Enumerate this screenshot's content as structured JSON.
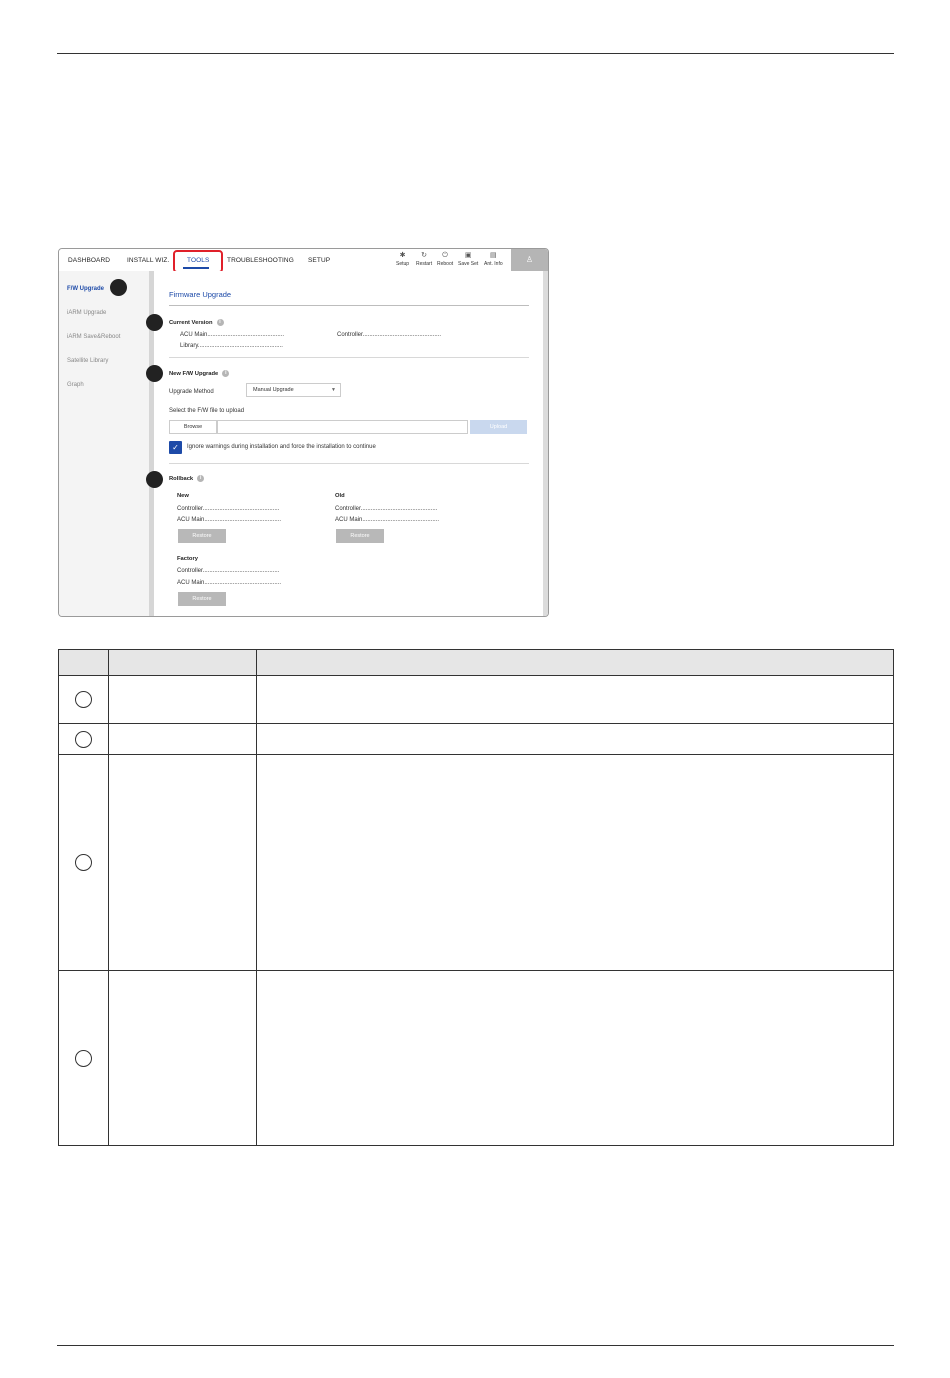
{
  "nav": {
    "tabs": [
      "DASHBOARD",
      "INSTALL WIZ.",
      "TOOLS",
      "TROUBLESHOOTING",
      "SETUP"
    ],
    "active_tab": "TOOLS",
    "tools": [
      {
        "label": "Setup",
        "icon": "gear-icon"
      },
      {
        "label": "Restart",
        "icon": "restart-icon"
      },
      {
        "label": "Reboot",
        "icon": "power-icon"
      },
      {
        "label": "Save Set",
        "icon": "save-icon"
      },
      {
        "label": "Ant. Info",
        "icon": "antenna-info-icon"
      }
    ],
    "user_icon": "user-icon"
  },
  "sidebar": {
    "items": [
      "F/W Upgrade",
      "iARM Upgrade",
      "iARM Save&Reboot",
      "Satellite Library",
      "Graph"
    ],
    "active_item": "F/W Upgrade"
  },
  "main": {
    "title": "Firmware Upgrade",
    "current_version": {
      "heading": "Current Version",
      "acu_main": "ACU Main..............................................",
      "controller": "Controller...............................................",
      "library": "Library..................................................."
    },
    "new_fw": {
      "heading": "New F/W Upgrade",
      "method_label": "Upgrade Method",
      "method_value": "Manual Upgrade",
      "select_file_label": "Select the F/W file to upload",
      "browse_label": "Browse",
      "upload_label": "Upload",
      "checkbox_label": "Ignore warnings during installation and force the installation to continue",
      "checkbox_checked": true
    },
    "rollback": {
      "heading": "Rollback",
      "new": {
        "heading": "New",
        "controller": "Controller..............................................",
        "acu_main": "ACU Main..............................................",
        "restore_label": "Restore"
      },
      "old": {
        "heading": "Old",
        "controller": "Controller..............................................",
        "acu_main": "ACU Main..............................................",
        "restore_label": "Restore"
      },
      "factory": {
        "heading": "Factory",
        "controller": "Controller..............................................",
        "acu_main": "ACU Main..............................................",
        "restore_label": "Restore"
      }
    }
  },
  "table": {
    "headers": [
      "",
      "",
      ""
    ],
    "rows": [
      {
        "item": "",
        "description": ""
      },
      {
        "item": "",
        "description": ""
      },
      {
        "item": "",
        "description": ""
      },
      {
        "item": "",
        "description": ""
      }
    ]
  }
}
